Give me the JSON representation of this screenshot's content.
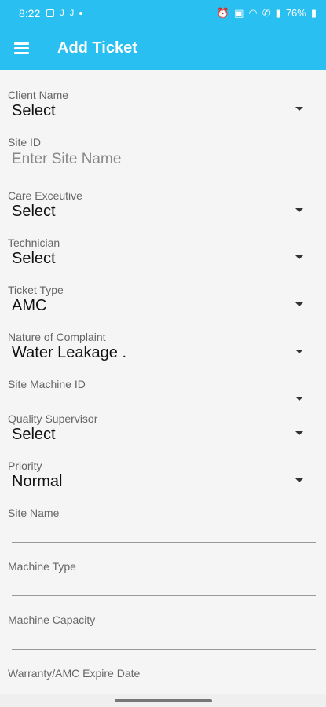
{
  "status_bar": {
    "time": "8:22",
    "left_icons": [
      "gallery-icon",
      "j-icon",
      "j-icon",
      "dot"
    ],
    "j1": "J",
    "j2": "J",
    "battery": "76%",
    "right_icons": [
      "alarm-icon",
      "nfc-icon",
      "wifi-icon",
      "call-icon",
      "signal-icon",
      "battery-icon"
    ]
  },
  "app_bar": {
    "title": "Add Ticket",
    "background": "#29bff0"
  },
  "form": {
    "client_name": {
      "label": "Client Name",
      "value": "Select"
    },
    "site_id": {
      "label": "Site ID",
      "placeholder": "Enter Site Name",
      "value": ""
    },
    "care_executive": {
      "label": "Care Exceutive",
      "value": "Select"
    },
    "technician": {
      "label": "Technician",
      "value": "Select"
    },
    "ticket_type": {
      "label": "Ticket Type",
      "value": "AMC"
    },
    "nature_of_complaint": {
      "label": "Nature of Complaint",
      "value": "Water Leakage ."
    },
    "site_machine_id": {
      "label": "Site Machine ID",
      "value": ""
    },
    "quality_supervisor": {
      "label": "Quality Supervisor",
      "value": "Select"
    },
    "priority": {
      "label": "Priority",
      "value": "Normal"
    },
    "site_name": {
      "label": "Site Name",
      "value": ""
    },
    "machine_type": {
      "label": "Machine Type",
      "value": ""
    },
    "machine_capacity": {
      "label": "Machine Capacity",
      "value": ""
    },
    "warranty_expire_date": {
      "label": "Warranty/AMC Expire Date"
    }
  }
}
